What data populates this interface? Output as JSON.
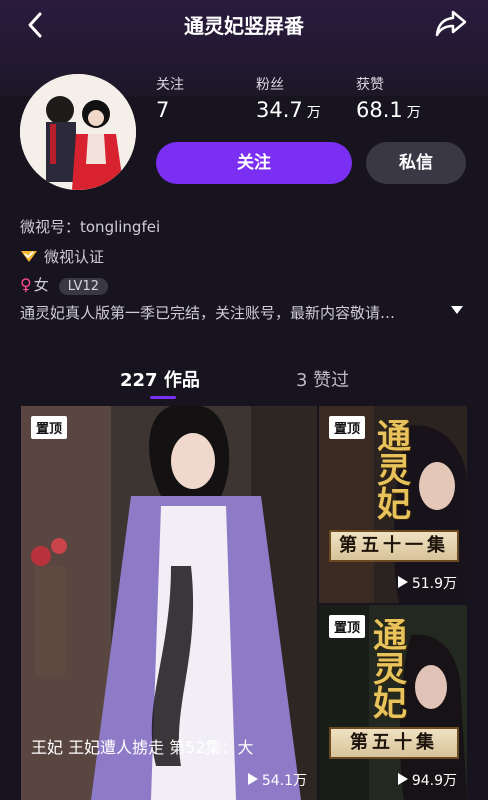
{
  "header": {
    "title": "通灵妃竖屏番",
    "back_icon": "back-arrow-icon",
    "share_icon": "share-icon"
  },
  "profile": {
    "stats": [
      {
        "label": "关注",
        "value": "7",
        "unit": ""
      },
      {
        "label": "粉丝",
        "value": "34.7",
        "unit": "万"
      },
      {
        "label": "获赞",
        "value": "68.1",
        "unit": "万"
      }
    ],
    "follow_label": "关注",
    "message_label": "私信",
    "weishi_id": "微视号：tonglingfei",
    "verified_label": "微视认证",
    "gender_label": "女",
    "level": "LV12",
    "bio": "通灵妃真人版第一季已完结，关注账号，最新内容敬请…"
  },
  "tabs": {
    "works": "227 作品",
    "liked": "3 赞过"
  },
  "videos": [
    {
      "pin": "置顶",
      "caption": "王妃  王妃遭人掳走   第52集：大",
      "plays": "54.1万"
    },
    {
      "pin": "置顶",
      "logo": "通灵妃",
      "episode": "第五十一集",
      "plays": "51.9万"
    },
    {
      "pin": "置顶",
      "logo": "通灵妃",
      "episode": "第五十集",
      "plays": "94.9万"
    }
  ],
  "colors": {
    "accent": "#7b2ff2",
    "background": "#17141f",
    "gender": "#ff4d8f",
    "verified": "#f5b731"
  }
}
